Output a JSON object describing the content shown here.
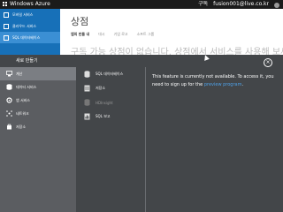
{
  "topbar": {
    "brand": "Windows Azure",
    "region": "구독",
    "user": "fusion001@live.co.kr"
  },
  "sidebar": {
    "items": [
      {
        "label": "모바일 서비스",
        "selected": false
      },
      {
        "label": "클라우드 서비스",
        "selected": false
      },
      {
        "label": "SQL 데이터베이스",
        "selected": true
      }
    ]
  },
  "main": {
    "title": "상점",
    "tabs": [
      "앱의 만들 내",
      "대시",
      "기업 로고",
      "소프트 그룹"
    ],
    "hero": "구독 가능 상점이 없습니다. 상점에서 서비스를 사용해 보세요"
  },
  "dialog": {
    "title": "새로 만들기",
    "categories": [
      {
        "label": "계산",
        "icon": "compute-icon",
        "selected": true
      },
      {
        "label": "데이터 서비스",
        "icon": "data-services-icon",
        "selected": false
      },
      {
        "label": "앱 서비스",
        "icon": "app-services-icon",
        "selected": false
      },
      {
        "label": "네트워크",
        "icon": "network-icon",
        "selected": false
      },
      {
        "label": "저장소",
        "icon": "store-icon",
        "selected": false
      }
    ],
    "services": [
      {
        "label": "SQL 데이터베이스",
        "icon": "sql-database-icon",
        "dim": false
      },
      {
        "label": "저장소",
        "icon": "storage-icon",
        "dim": false
      },
      {
        "label": "HDInsight",
        "icon": "hdinsight-icon",
        "dim": true
      },
      {
        "label": "SQL 보고",
        "icon": "sql-reporting-icon",
        "dim": false
      }
    ],
    "message": "This feature is currently not available. To access it, you need to sign up for the",
    "link": "preview program",
    "message_end": "."
  }
}
